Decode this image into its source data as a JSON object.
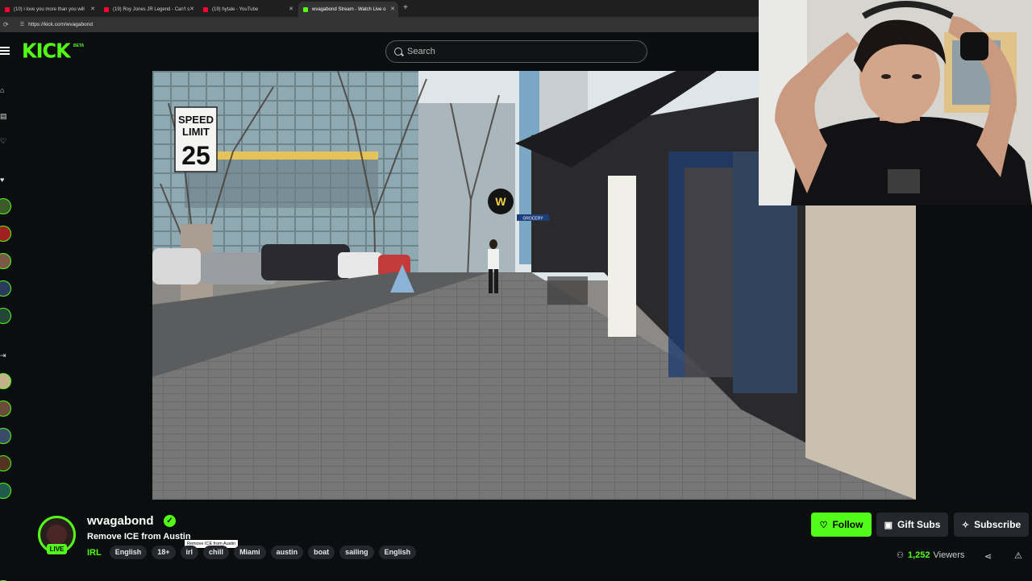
{
  "browser": {
    "tabs": [
      {
        "title": "(10) i love you more than you will",
        "favicon": "youtube"
      },
      {
        "title": "(19) Roy Jones JR Legend - Can't s",
        "favicon": "youtube"
      },
      {
        "title": "(19) hytale - YouTube",
        "favicon": "youtube"
      },
      {
        "title": "wvagabond Stream - Watch Live o",
        "favicon": "kick",
        "active": true
      }
    ],
    "new_tab": "+",
    "url": "https://kick.com/wvagabond"
  },
  "header": {
    "logo": "KICK",
    "logo_badge": "BETA",
    "search_placeholder": "Search"
  },
  "video_scene": {
    "speed_sign_line1": "SPEED",
    "speed_sign_line2": "LIMIT",
    "speed_sign_value": "25",
    "store_sign": "GROCERY"
  },
  "channel": {
    "name": "wvagabond",
    "live_label": "LIVE",
    "stream_title": "Remove ICE from Austin",
    "tooltip": "Remove ICE from Austin",
    "category": "IRL",
    "tags": [
      "English",
      "18+",
      "irl",
      "chill",
      "Miami",
      "austin",
      "boat",
      "sailing",
      "English"
    ],
    "follow_label": "Follow",
    "gift_label": "Gift Subs",
    "subscribe_label": "Subscribe",
    "viewer_count": "1,252",
    "viewer_label": "Viewers"
  },
  "colors": {
    "accent": "#53fc18",
    "background": "#0b0e0f",
    "button_dark": "#24272c"
  }
}
